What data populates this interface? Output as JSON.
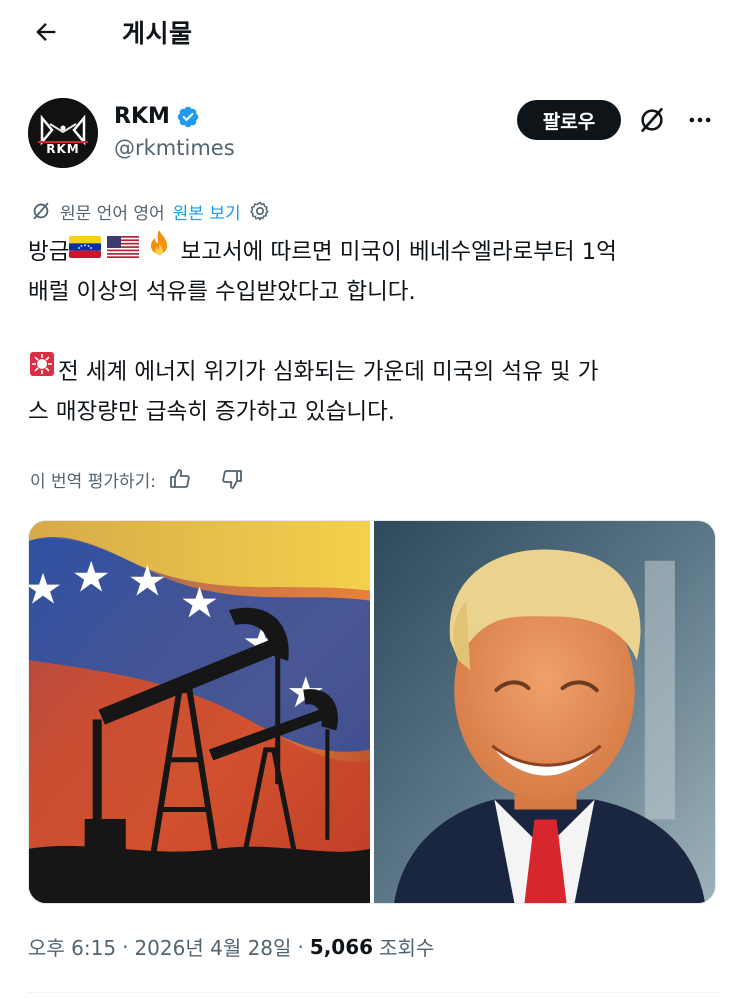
{
  "header": {
    "title": "게시물"
  },
  "author": {
    "name": "RKM",
    "handle": "@rkmtimes",
    "avatar_text": "RKM",
    "follow_label": "팔로우"
  },
  "translate": {
    "label": "원문 언어 영어",
    "link": "원본 보기"
  },
  "tweet": {
    "line1_pre": "방금",
    "line1_post": " 보고서에 따르면 미국이 베네수엘라로부터 1억",
    "line2": "배럴 이상의 석유를 수입받았다고 합니다.",
    "line3": "전 세계 에너지 위기가 심화되는 가운데 미국의 석유 및 가",
    "line4": "스 매장량만 급속히 증가하고 있습니다."
  },
  "rate": {
    "label": "이 번역 평가하기:"
  },
  "meta": {
    "time": "오후 6:15",
    "date": "2026년 4월 28일",
    "views": "5,066",
    "views_label": "조회수"
  },
  "icons": {
    "back": "arrow-left-icon",
    "verified": "verified-badge-icon",
    "grok": "grok-icon",
    "more": "more-icon",
    "translate": "translate-icon",
    "settings": "gear-icon",
    "thumbs_up": "thumbs-up-icon",
    "thumbs_down": "thumbs-down-icon",
    "emoji_flag_ve": "venezuela-flag-icon",
    "emoji_flag_us": "us-flag-icon",
    "emoji_fire": "fire-icon",
    "emoji_siren": "siren-icon"
  },
  "colors": {
    "accent": "#1d9bf0",
    "text": "#0f1419",
    "muted": "#536471"
  }
}
